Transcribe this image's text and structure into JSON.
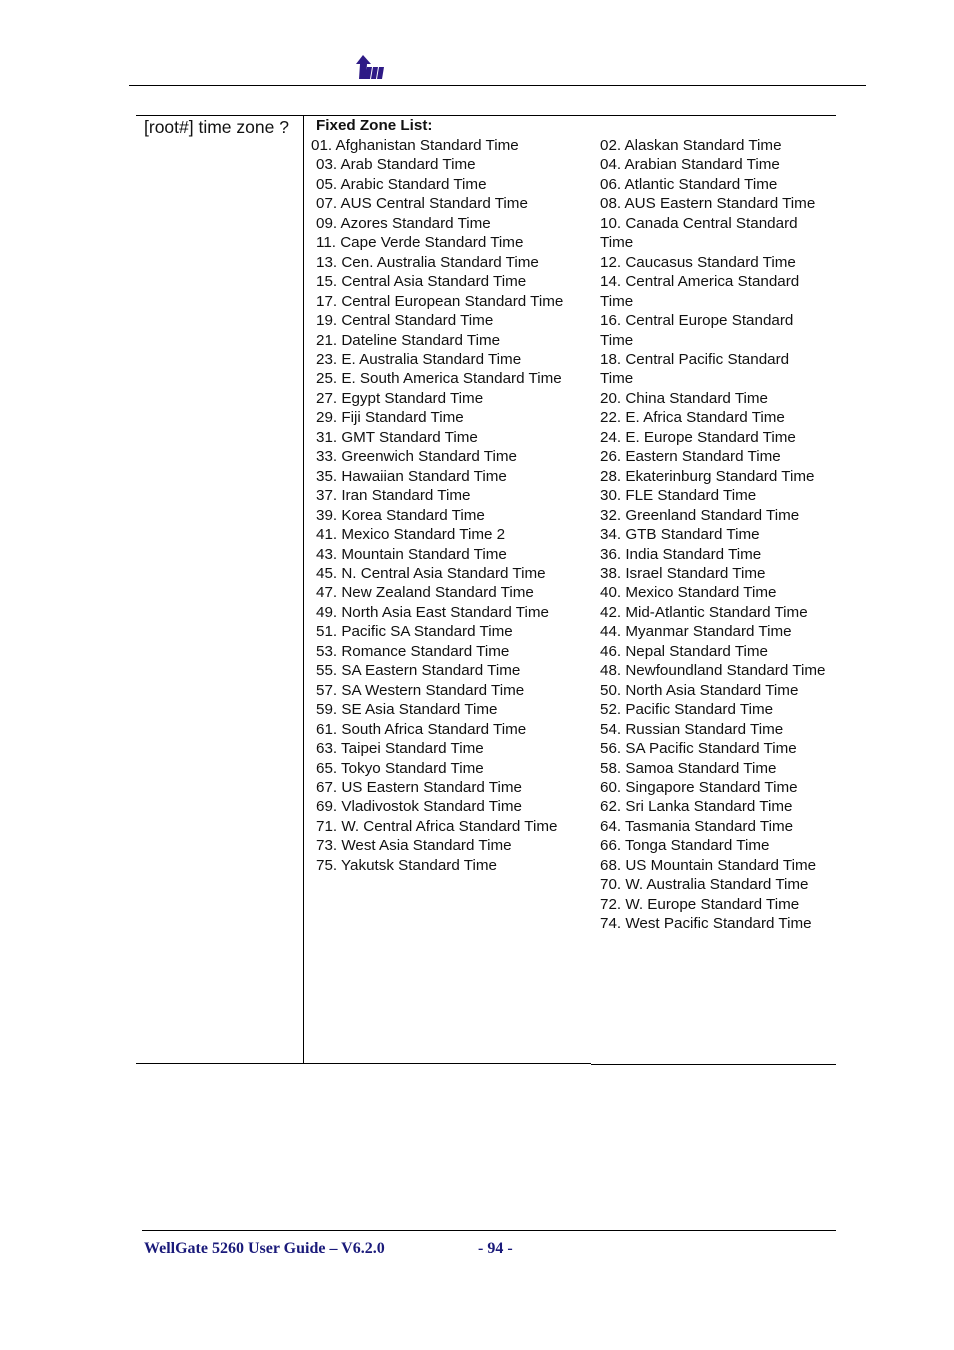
{
  "header": {
    "logo_icon": "wellgate-arrow-logo-icon",
    "brand_color": "#2e1a86"
  },
  "command_cell": {
    "text": "[root#] time zone ?"
  },
  "zone_list": {
    "title": "Fixed Zone List:",
    "left_column": [
      "01. Afghanistan Standard Time",
      "03. Arab Standard Time",
      "05. Arabic Standard Time",
      "07. AUS Central Standard Time",
      "09. Azores Standard Time",
      "11. Cape Verde Standard Time",
      "13. Cen. Australia Standard Time",
      "15. Central Asia Standard Time",
      "17. Central European Standard Time",
      "19. Central Standard Time",
      "21. Dateline Standard Time",
      "23. E. Australia Standard Time",
      "25. E. South America Standard Time",
      "27. Egypt Standard Time",
      "29. Fiji Standard Time",
      "31. GMT Standard Time",
      "33. Greenwich Standard Time",
      "35. Hawaiian Standard Time",
      "37. Iran Standard Time",
      "39. Korea Standard Time",
      "41. Mexico Standard Time 2",
      "43. Mountain Standard Time",
      "45. N. Central Asia Standard Time",
      "47. New Zealand Standard Time",
      "49. North Asia East Standard Time",
      "51. Pacific SA Standard Time",
      "53. Romance Standard Time",
      "55. SA Eastern Standard Time",
      "57. SA Western Standard Time",
      "59. SE Asia Standard Time",
      "61. South Africa Standard Time",
      "63. Taipei Standard Time",
      "65. Tokyo Standard Time",
      "67. US Eastern Standard Time",
      "69. Vladivostok Standard Time",
      "71. W. Central Africa Standard Time",
      "73. West Asia Standard Time",
      "75. Yakutsk Standard Time"
    ],
    "right_column": [
      "02. Alaskan Standard Time",
      "04. Arabian Standard Time",
      "06. Atlantic Standard Time",
      "08. AUS Eastern Standard Time",
      "10. Canada Central Standard Time",
      "12. Caucasus Standard Time",
      "14. Central America Standard Time",
      "16. Central Europe Standard Time",
      "18. Central Pacific Standard Time",
      "20. China Standard Time",
      "22. E. Africa Standard Time",
      "24. E. Europe Standard Time",
      "26. Eastern Standard Time",
      "28. Ekaterinburg Standard Time",
      "30. FLE Standard Time",
      "32. Greenland Standard Time",
      "34. GTB Standard Time",
      "36. India Standard Time",
      "38. Israel Standard Time",
      "40. Mexico Standard Time",
      "42. Mid-Atlantic Standard Time",
      "44. Myanmar Standard Time",
      "46. Nepal Standard Time",
      "48. Newfoundland Standard Time",
      "50. North Asia Standard Time",
      "52. Pacific Standard Time",
      "54. Russian Standard Time",
      "56. SA Pacific Standard Time",
      "58. Samoa Standard Time",
      "60. Singapore Standard Time",
      "62. Sri Lanka Standard Time",
      "64. Tasmania Standard Time",
      "66. Tonga Standard Time",
      "68. US Mountain Standard Time",
      "70. W. Australia Standard Time",
      "72. W. Europe Standard Time",
      "74. West Pacific Standard Time"
    ]
  },
  "footer": {
    "title": "WellGate 5260 User Guide – V6.2.0",
    "page": "- 94 -"
  }
}
